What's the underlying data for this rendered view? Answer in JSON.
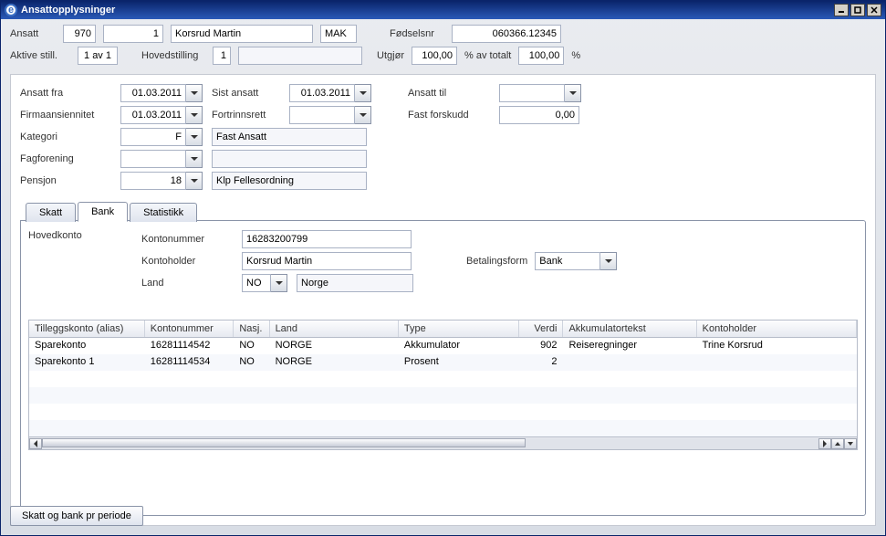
{
  "window": {
    "title": "Ansattopplysninger"
  },
  "header": {
    "ansatt_label": "Ansatt",
    "ansatt_kode": "970",
    "ansatt_nr": "1",
    "ansatt_navn": "Korsrud Martin",
    "init": "MAK",
    "fodselsnr_label": "Fødselsnr",
    "fodselsnr": "060366.12345",
    "aktive_label": "Aktive still.",
    "aktive": "1 av 1",
    "hovedstilling_label": "Hovedstilling",
    "hovedstilling": "1",
    "utgjor_label": "Utgjør",
    "utgjor_pct": "100,00",
    "pct_total_label": "% av totalt",
    "pct_total": "100,00",
    "pct": "%"
  },
  "form": {
    "ansatt_fra_label": "Ansatt fra",
    "ansatt_fra": "01.03.2011",
    "sist_ansatt_label": "Sist ansatt",
    "sist_ansatt": "01.03.2011",
    "ansatt_til_label": "Ansatt til",
    "ansatt_til": "",
    "firma_label": "Firmaansiennitet",
    "firma": "01.03.2011",
    "fortrinn_label": "Fortrinnsrett",
    "fortrinn": "",
    "fast_label": "Fast forskudd",
    "fast": "0,00",
    "kategori_label": "Kategori",
    "kategori": "F",
    "kategori_txt": "Fast Ansatt",
    "fagforening_label": "Fagforening",
    "fagforening": "",
    "fagforening_txt": "",
    "pensjon_label": "Pensjon",
    "pensjon": "18",
    "pensjon_txt": "Klp Fellesordning"
  },
  "tabs": {
    "skatt": "Skatt",
    "bank": "Bank",
    "statistikk": "Statistikk"
  },
  "bank": {
    "hovedkonto_label": "Hovedkonto",
    "kontonummer_label": "Kontonummer",
    "kontonummer": "16283200799",
    "kontoholder_label": "Kontoholder",
    "kontoholder": "Korsrud Martin",
    "land_label": "Land",
    "land_kode": "NO",
    "land_navn": "Norge",
    "betalingsform_label": "Betalingsform",
    "betalingsform": "Bank"
  },
  "grid": {
    "headers": {
      "alias": "Tilleggskonto (alias)",
      "konto": "Kontonummer",
      "nasj": "Nasj.",
      "land": "Land",
      "type": "Type",
      "verdi": "Verdi",
      "akk": "Akkumulatortekst",
      "holder": "Kontoholder"
    },
    "rows": [
      {
        "alias": "Sparekonto",
        "konto": "16281114542",
        "nasj": "NO",
        "land": "NORGE",
        "type": "Akkumulator",
        "verdi": "902",
        "akk": "Reiseregninger",
        "holder": "Trine Korsrud"
      },
      {
        "alias": "Sparekonto 1",
        "konto": "16281114534",
        "nasj": "NO",
        "land": "NORGE",
        "type": "Prosent",
        "verdi": "2",
        "akk": "",
        "holder": ""
      }
    ]
  },
  "footer": {
    "button": "Skatt og bank pr periode"
  }
}
